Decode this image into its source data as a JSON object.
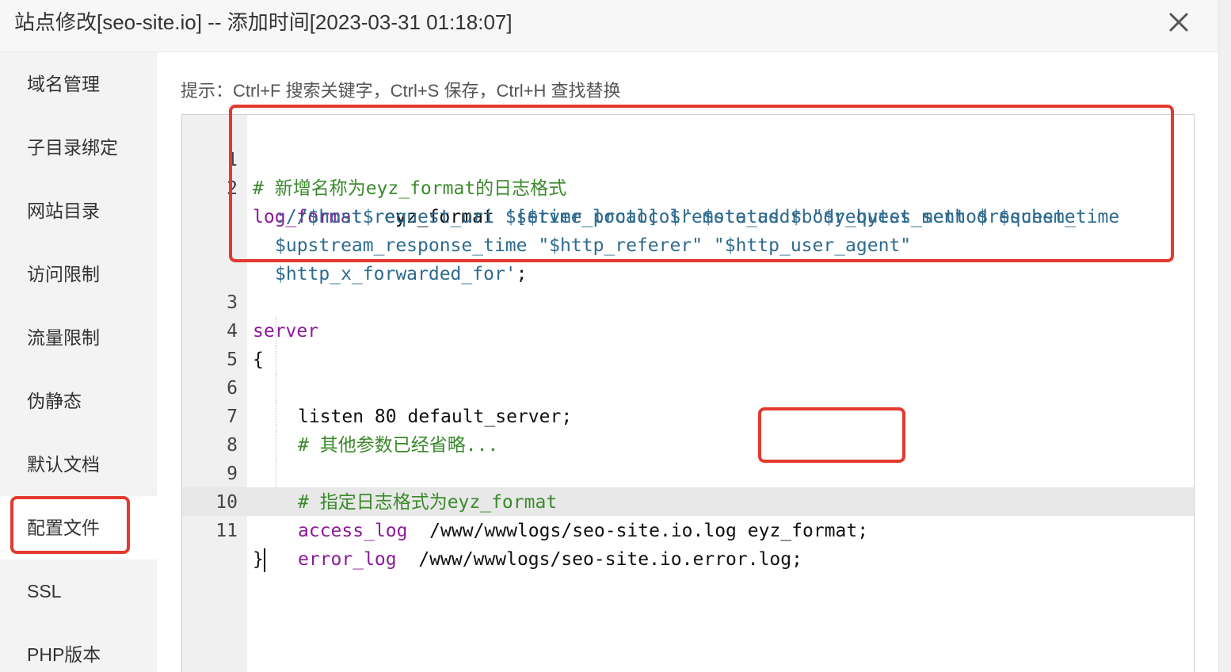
{
  "dialog": {
    "title": "站点修改[seo-site.io] -- 添加时间[2023-03-31 01:18:07]",
    "close_icon": "close-icon"
  },
  "sidebar": {
    "items": [
      {
        "label": "域名管理",
        "active": false
      },
      {
        "label": "子目录绑定",
        "active": false
      },
      {
        "label": "网站目录",
        "active": false
      },
      {
        "label": "访问限制",
        "active": false
      },
      {
        "label": "流量限制",
        "active": false
      },
      {
        "label": "伪静态",
        "active": false
      },
      {
        "label": "默认文档",
        "active": false
      },
      {
        "label": "配置文件",
        "active": true
      },
      {
        "label": "SSL",
        "active": false
      },
      {
        "label": "PHP版本",
        "active": false
      }
    ]
  },
  "main": {
    "hint": "提示：Ctrl+F 搜索关键字，Ctrl+S 保存，Ctrl+H 查找替换"
  },
  "editor": {
    "line_numbers": [
      "1",
      "2",
      "3",
      "4",
      "5",
      "6",
      "7",
      "8",
      "9",
      "10",
      "11"
    ],
    "line1": {
      "comment": "# 新增名称为eyz_format的日志格式"
    },
    "line2": {
      "kw": "log_format",
      "name": "  eyz_format ",
      "seg1": "'[$time_local] $remote_addr \"$request_method $scheme",
      "seg2": "://$host$request_uri $server_protocol\" $status $body_bytes_sent $request_time",
      "seg3": "$upstream_response_time \"$http_referer\" \"$http_user_agent\"",
      "seg4": "$http_x_forwarded_for'",
      "end": ";"
    },
    "line3": {
      "kw": "server"
    },
    "line4": {
      "text": "{"
    },
    "line5": {
      "text": "listen 80 default_server;"
    },
    "line6": {
      "comment": "# 其他参数已经省略..."
    },
    "line7": {
      "text": ""
    },
    "line8": {
      "comment": "# 指定日志格式为eyz_format"
    },
    "line9": {
      "kw": "access_log",
      "path": "  /www/wwwlogs/seo-site.io.log ",
      "fmt": "eyz_format;"
    },
    "line10": {
      "kw": "error_log",
      "path": "  /www/wwwlogs/seo-site.io.error.log;"
    },
    "line11": {
      "text": "}"
    }
  },
  "colors": {
    "highlight": "#e23a2f",
    "comment": "#3b8a2c",
    "keyword": "#8b1a9a",
    "string": "#2f6b8f"
  }
}
